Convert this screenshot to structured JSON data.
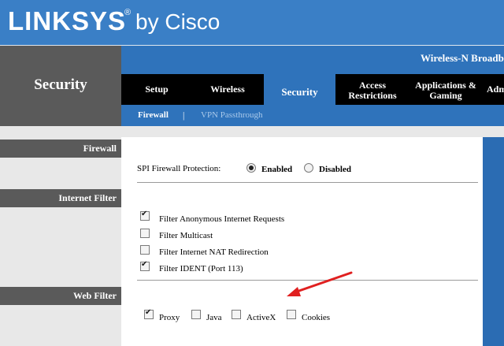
{
  "brand": {
    "logo": "LINKSYS",
    "reg_mark": "®",
    "by": "by Cisco"
  },
  "section_title": "Security",
  "model_name": "Wireless-N Broadb",
  "tabs": [
    {
      "label": "Setup",
      "active": false
    },
    {
      "label": "Wireless",
      "active": false
    },
    {
      "label": "Security",
      "active": true
    },
    {
      "label": "Access\nRestrictions",
      "active": false
    },
    {
      "label": "Applications &\nGaming",
      "active": false
    },
    {
      "label": "Adm",
      "active": false
    }
  ],
  "subtabs": {
    "firewall": "Firewall",
    "separator": "|",
    "vpn": "VPN Passthrough"
  },
  "left_labels": {
    "firewall": "Firewall",
    "internet_filter": "Internet Filter",
    "web_filter": "Web Filter"
  },
  "firewall": {
    "label": "SPI Firewall Protection:",
    "enabled_label": "Enabled",
    "disabled_label": "Disabled",
    "selected": "Enabled"
  },
  "internet_filter": {
    "items": [
      {
        "label": "Filter Anonymous Internet Requests",
        "checked": true
      },
      {
        "label": "Filter Multicast",
        "checked": false
      },
      {
        "label": "Filter Internet NAT Redirection",
        "checked": false
      },
      {
        "label": "Filter IDENT (Port 113)",
        "checked": true
      }
    ]
  },
  "web_filter": {
    "items": [
      {
        "label": "Proxy",
        "checked": true
      },
      {
        "label": "Java",
        "checked": false
      },
      {
        "label": "ActiveX",
        "checked": false
      },
      {
        "label": "Cookies",
        "checked": false
      }
    ]
  },
  "colors": {
    "header_blue": "#3a7fc6",
    "nav_blue": "#2f73bb",
    "dark_gray": "#5a5a5a",
    "annotation_red": "#e02020"
  }
}
